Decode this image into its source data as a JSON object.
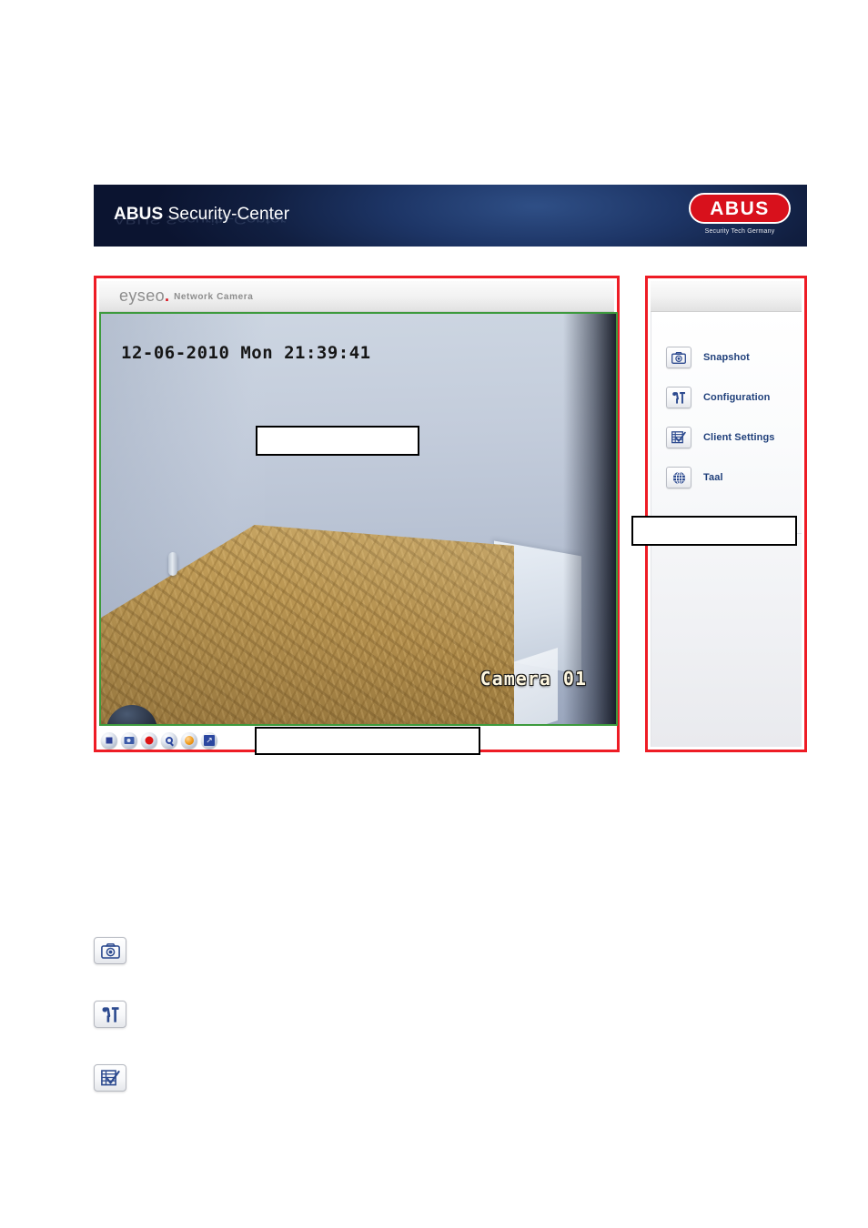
{
  "banner": {
    "brand_bold": "ABUS",
    "brand_light": " Security-Center",
    "logo_text": "ABUS",
    "logo_tagline": "Security Tech Germany",
    "logo_color": "#d8111c",
    "background_color": "#16264b"
  },
  "viewer": {
    "brand_word": "eyseo",
    "brand_dot": ".",
    "brand_sub": "Network Camera",
    "accent_color": "#d8111c",
    "annotation_border_color": "#ee1c25",
    "video_border_color": "#3d9a3d",
    "osd_timestamp": "12-06-2010 Mon 21:39:41",
    "osd_camera_name": "Camera 01",
    "toolbar": [
      {
        "name": "stop",
        "glyph": "g-stop"
      },
      {
        "name": "snapshot",
        "glyph": "g-cam"
      },
      {
        "name": "record",
        "glyph": "g-rec"
      },
      {
        "name": "zoom",
        "glyph": "g-zoom"
      },
      {
        "name": "audio",
        "glyph": "g-audio"
      },
      {
        "name": "fullscreen",
        "glyph": "g-full"
      }
    ]
  },
  "menu": {
    "annotation_border_color": "#ee1c25",
    "label_color": "#1f3f7a",
    "items": [
      {
        "label": "Snapshot",
        "icon": "camera-icon"
      },
      {
        "label": "Configuration",
        "icon": "tools-icon"
      },
      {
        "label": "Client Settings",
        "icon": "form-check-icon"
      },
      {
        "label": "Taal",
        "icon": "globe-icon"
      }
    ]
  },
  "redactions": [
    {
      "name": "video-mid-redaction"
    },
    {
      "name": "video-bottom-redaction"
    },
    {
      "name": "menu-redaction"
    }
  ],
  "document_icons": [
    {
      "icon": "camera-icon"
    },
    {
      "icon": "tools-icon"
    },
    {
      "icon": "form-check-icon"
    }
  ]
}
